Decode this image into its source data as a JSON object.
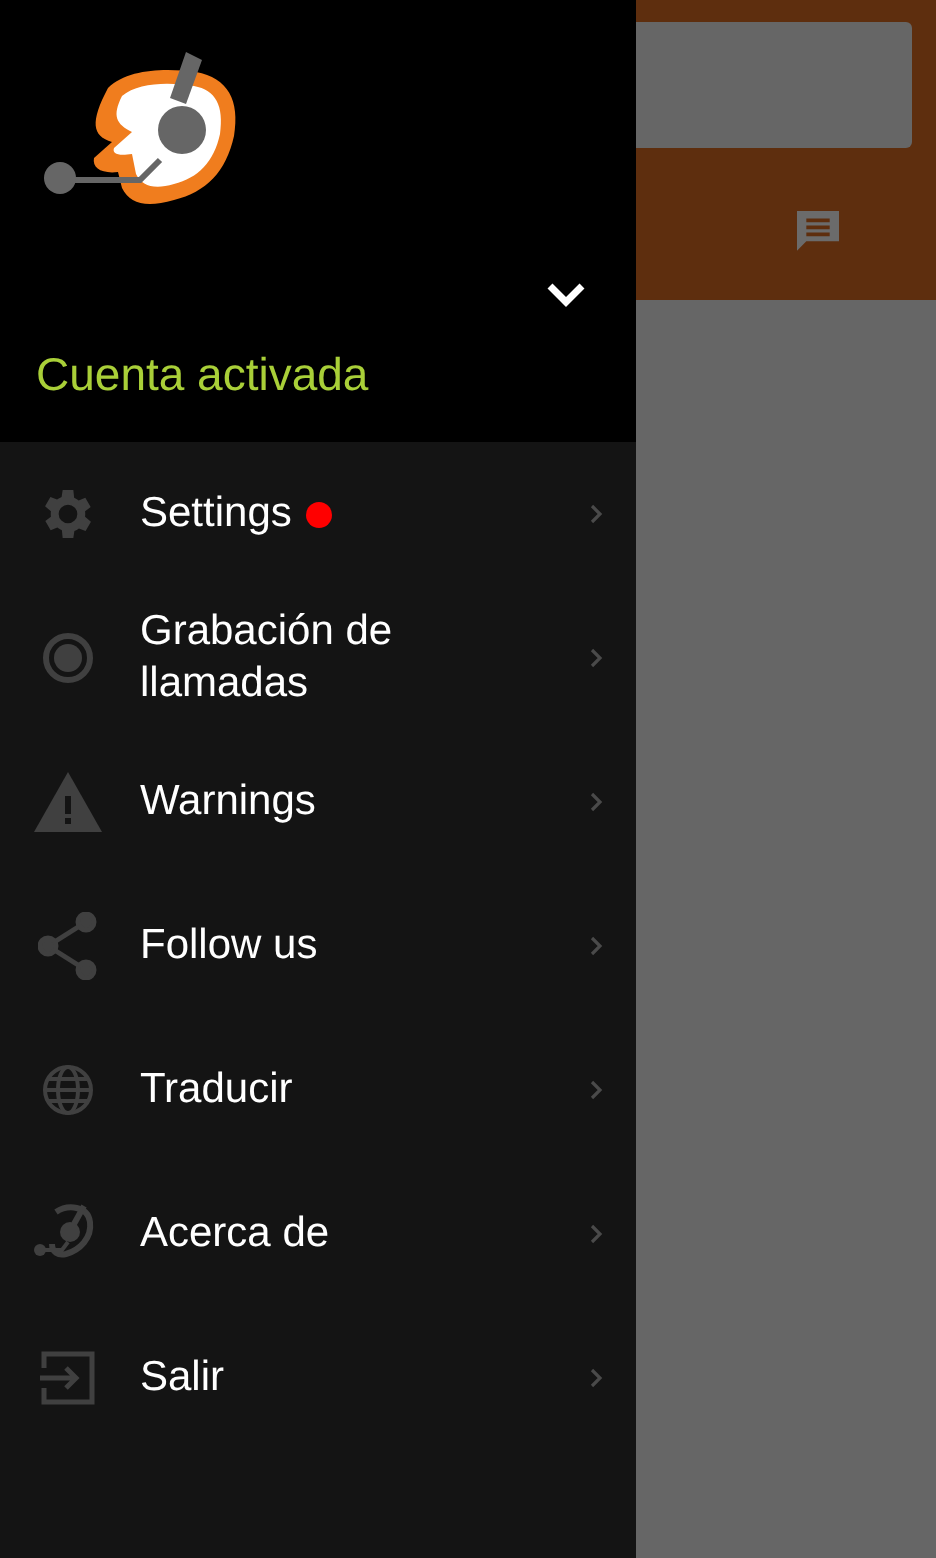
{
  "drawer": {
    "account_status": "Cuenta activada",
    "account_menu_expanded": false,
    "items": [
      {
        "label": "Settings",
        "kind": "gear",
        "badge": true
      },
      {
        "label": "Grabación de llamadas",
        "kind": "record",
        "badge": false
      },
      {
        "label": "Warnings",
        "kind": "warning",
        "badge": false
      },
      {
        "label": "Follow us",
        "kind": "share",
        "badge": false
      },
      {
        "label": "Traducir",
        "kind": "globe",
        "badge": false
      },
      {
        "label": "Acerca de",
        "kind": "headset",
        "badge": false
      },
      {
        "label": "Salir",
        "kind": "exit",
        "badge": false
      }
    ]
  }
}
